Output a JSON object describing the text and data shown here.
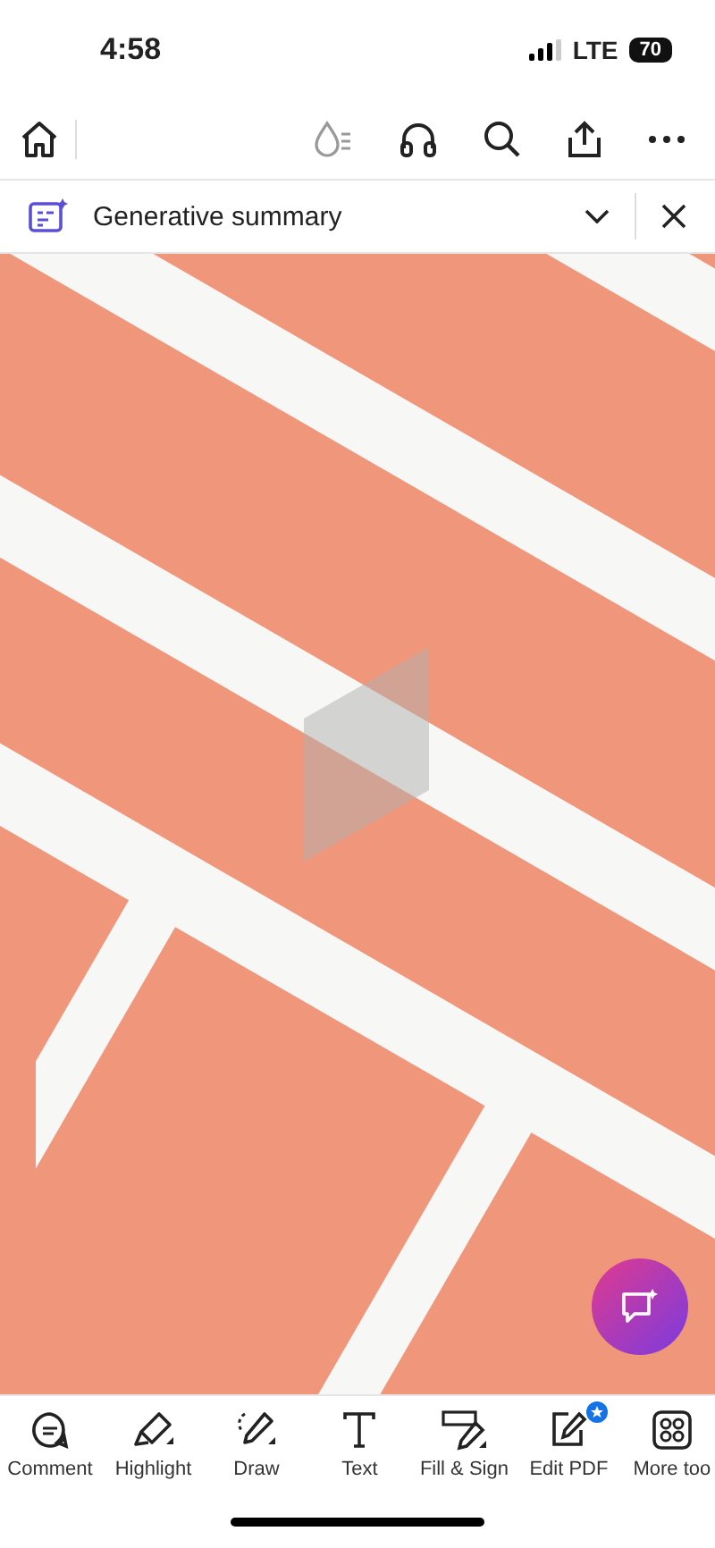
{
  "status_bar": {
    "time": "4:58",
    "network": "LTE",
    "battery": "70"
  },
  "summary_bar": {
    "title": "Generative summary"
  },
  "tools": [
    {
      "kind": "comment",
      "label": "Comment",
      "badge": false
    },
    {
      "kind": "highlight",
      "label": "Highlight",
      "badge": false
    },
    {
      "kind": "draw",
      "label": "Draw",
      "badge": false
    },
    {
      "kind": "text",
      "label": "Text",
      "badge": false
    },
    {
      "kind": "sign",
      "label": "Fill & Sign",
      "badge": false
    },
    {
      "kind": "edit",
      "label": "Edit PDF",
      "badge": true
    },
    {
      "kind": "more",
      "label": "More too",
      "badge": false
    }
  ]
}
